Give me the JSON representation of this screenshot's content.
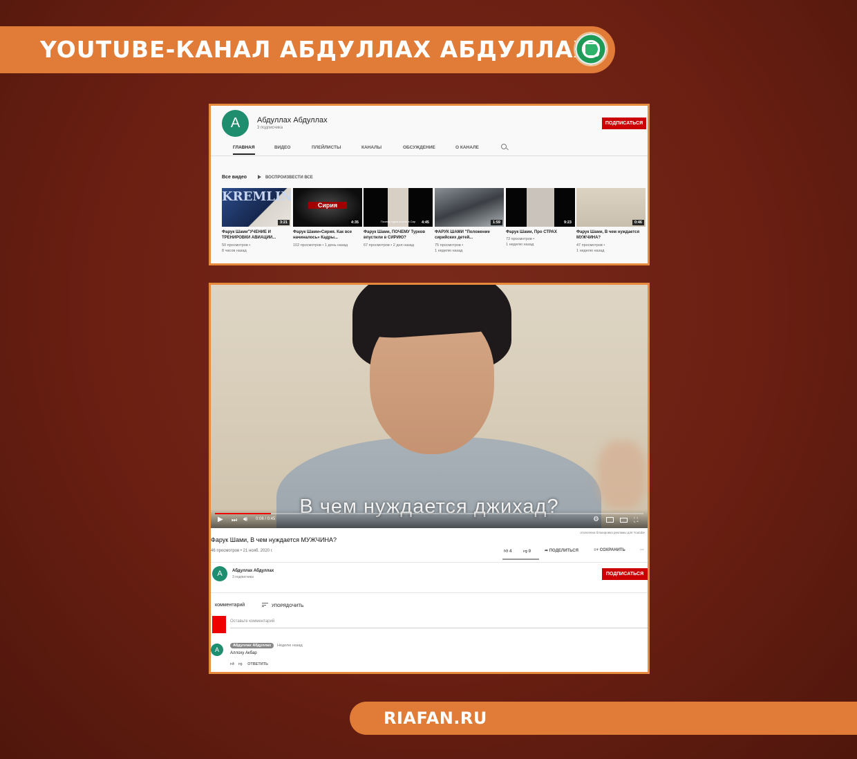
{
  "header": {
    "title": "YOUTUBE-КАНАЛ АБДУЛЛАХ АБДУЛЛАХ",
    "logo_icon": "riafan-globe-icon"
  },
  "channel": {
    "avatar_letter": "A",
    "name": "Абдуллах Абдуллах",
    "subscribers": "3 подписчика",
    "subscribe_label": "ПОДПИСАТЬСЯ",
    "tabs": [
      "ГЛАВНАЯ",
      "ВИДЕО",
      "ПЛЕЙЛИСТЫ",
      "КАНАЛЫ",
      "ОБСУЖДЕНИЕ",
      "О КАНАЛЕ"
    ],
    "section_title": "Все видео",
    "play_all": "ВОСПРОИЗВЕСТИ ВСЕ",
    "videos": [
      {
        "title": "Фарук Шами\"УЧЕНИЕ И ТРЕНИРОВКИ АВИАЦИИ...",
        "views": "50 просмотров",
        "age": "8 часов назад",
        "duration": "3:21",
        "overlay": "KREMLIN"
      },
      {
        "title": "Фарук Шами»Сирия. Как все начиналось» Кадры...",
        "views": "102 просмотров",
        "age": "1 день назад",
        "duration": "4:35",
        "overlay": "Сирия"
      },
      {
        "title": "Фарук Шами, ПОЧЕМУ Турков впустили в СИРИЮ?",
        "views": "67 просмотров",
        "age": "2 дня назад",
        "duration": "4:45",
        "overlay": "Почему турки вошли в Сир"
      },
      {
        "title": "ФАРУК ШАМИ \"Положение сирийских детей...",
        "views": "75 просмотров",
        "age": "1 неделю назад",
        "duration": "1:59",
        "overlay": ""
      },
      {
        "title": "Фарук Шами, Про СТРАХ",
        "views": "73 просмотров",
        "age": "1 неделю назад",
        "duration": "9:23",
        "overlay": ""
      },
      {
        "title": "Фарук Шами, В чем нуждается МУЖЧИНА?",
        "views": "47 просмотров",
        "age": "1 неделю назад",
        "duration": "0:46",
        "overlay": ""
      }
    ]
  },
  "watch": {
    "subtitle": "В чем нуждается джихад?",
    "time": "0:06 / 0:45",
    "progress": 0.13,
    "ad_note": "отключена блокировка рекламы для Youtube",
    "title": "Фарук Шами, В чем нуждается МУЖЧИНА?",
    "meta": "46 просмотров • 21 нояб. 2020 г.",
    "likes": "4",
    "dislikes": "0",
    "share_label": "ПОДЕЛИТЬСЯ",
    "save_label": "СОХРАНИТЬ",
    "owner_name": "Абдуллах Абдуллах",
    "owner_subs": "3 подписчика",
    "subscribe_label": "ПОДПИСАТЬСЯ",
    "comments_heading": "комментарий",
    "sort_label": "УПОРЯДОЧИТЬ",
    "comment_placeholder": "Оставьте комментарий",
    "comment": {
      "author": "Абдуллах Абдуллах",
      "time": "Неделю назад",
      "text": "Аллоху Акбар",
      "reply_label": "ОТВЕТИТЬ"
    }
  },
  "footer": {
    "site": "RIAFAN.RU"
  },
  "colors": {
    "background": "#6a1f12",
    "banner": "#e07b38",
    "subscribe": "#cc0000",
    "avatar": "#1e8e6e"
  }
}
